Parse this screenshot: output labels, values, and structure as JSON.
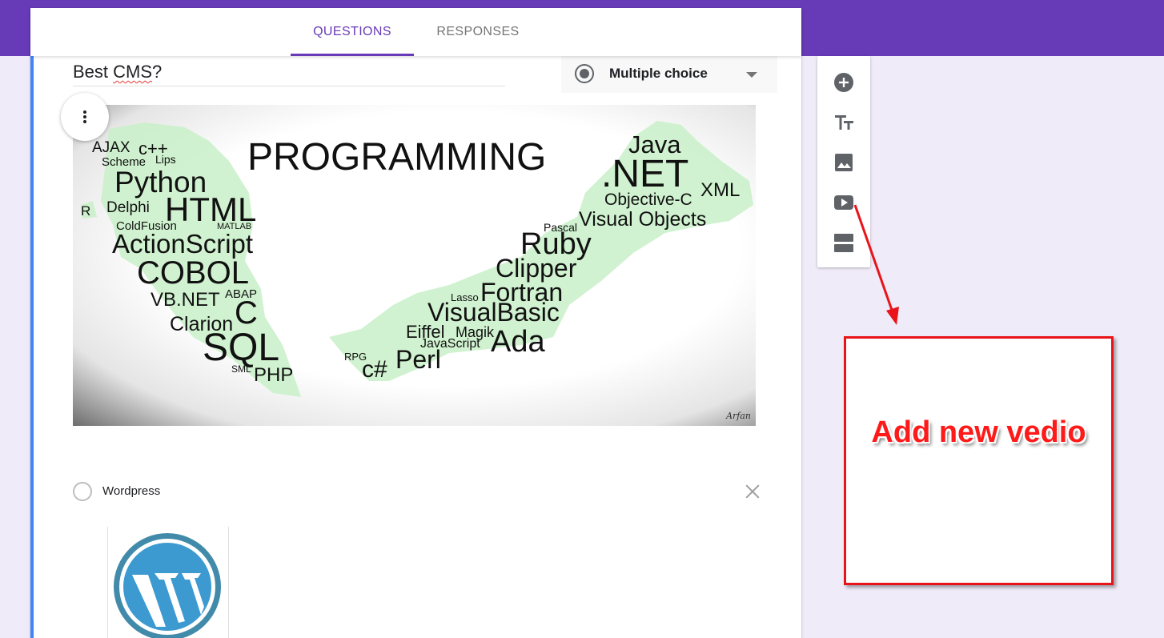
{
  "colors": {
    "brand": "#673ab7",
    "active": "#4285f4",
    "annotation": "#e8141a"
  },
  "tabs": [
    {
      "label": "QUESTIONS",
      "active": true
    },
    {
      "label": "RESPONSES",
      "active": false
    }
  ],
  "question": {
    "title_main": "Best ",
    "title_flagged": "CMS",
    "title_end": "?",
    "type": "Multiple choice",
    "type_icon": "radio-button-icon",
    "menu_icon": "more-vertical-icon"
  },
  "image_words": [
    "PROGRAMMING",
    "Java",
    ".NET",
    "XML",
    "Objective-C",
    "Visual Objects",
    "Pascal",
    "Ruby",
    "Clipper",
    "Fortran",
    "Lasso",
    "VisualBasic",
    "Eiffel",
    "Magik",
    "JavaScript",
    "Ada",
    "RPG",
    "c#",
    "Perl",
    "AJAX",
    "c++",
    "Scheme",
    "Lips",
    "Python",
    "R",
    "Delphi",
    "HTML",
    "ColdFusion",
    "MATLAB",
    "ActionScript",
    "COBOL",
    "VB.NET",
    "ABAP",
    "C",
    "Clarion",
    "SQL",
    "SML",
    "PHP"
  ],
  "image_signature": "Arfan",
  "option": {
    "label": "Wordpress",
    "image_icon": "wordpress-logo-icon",
    "remove_icon": "close-icon"
  },
  "toolbar": [
    {
      "name": "add-question-icon"
    },
    {
      "name": "title-text-icon"
    },
    {
      "name": "image-icon"
    },
    {
      "name": "video-icon"
    },
    {
      "name": "section-icon"
    }
  ],
  "annotation": {
    "text": "Add new vedio"
  }
}
